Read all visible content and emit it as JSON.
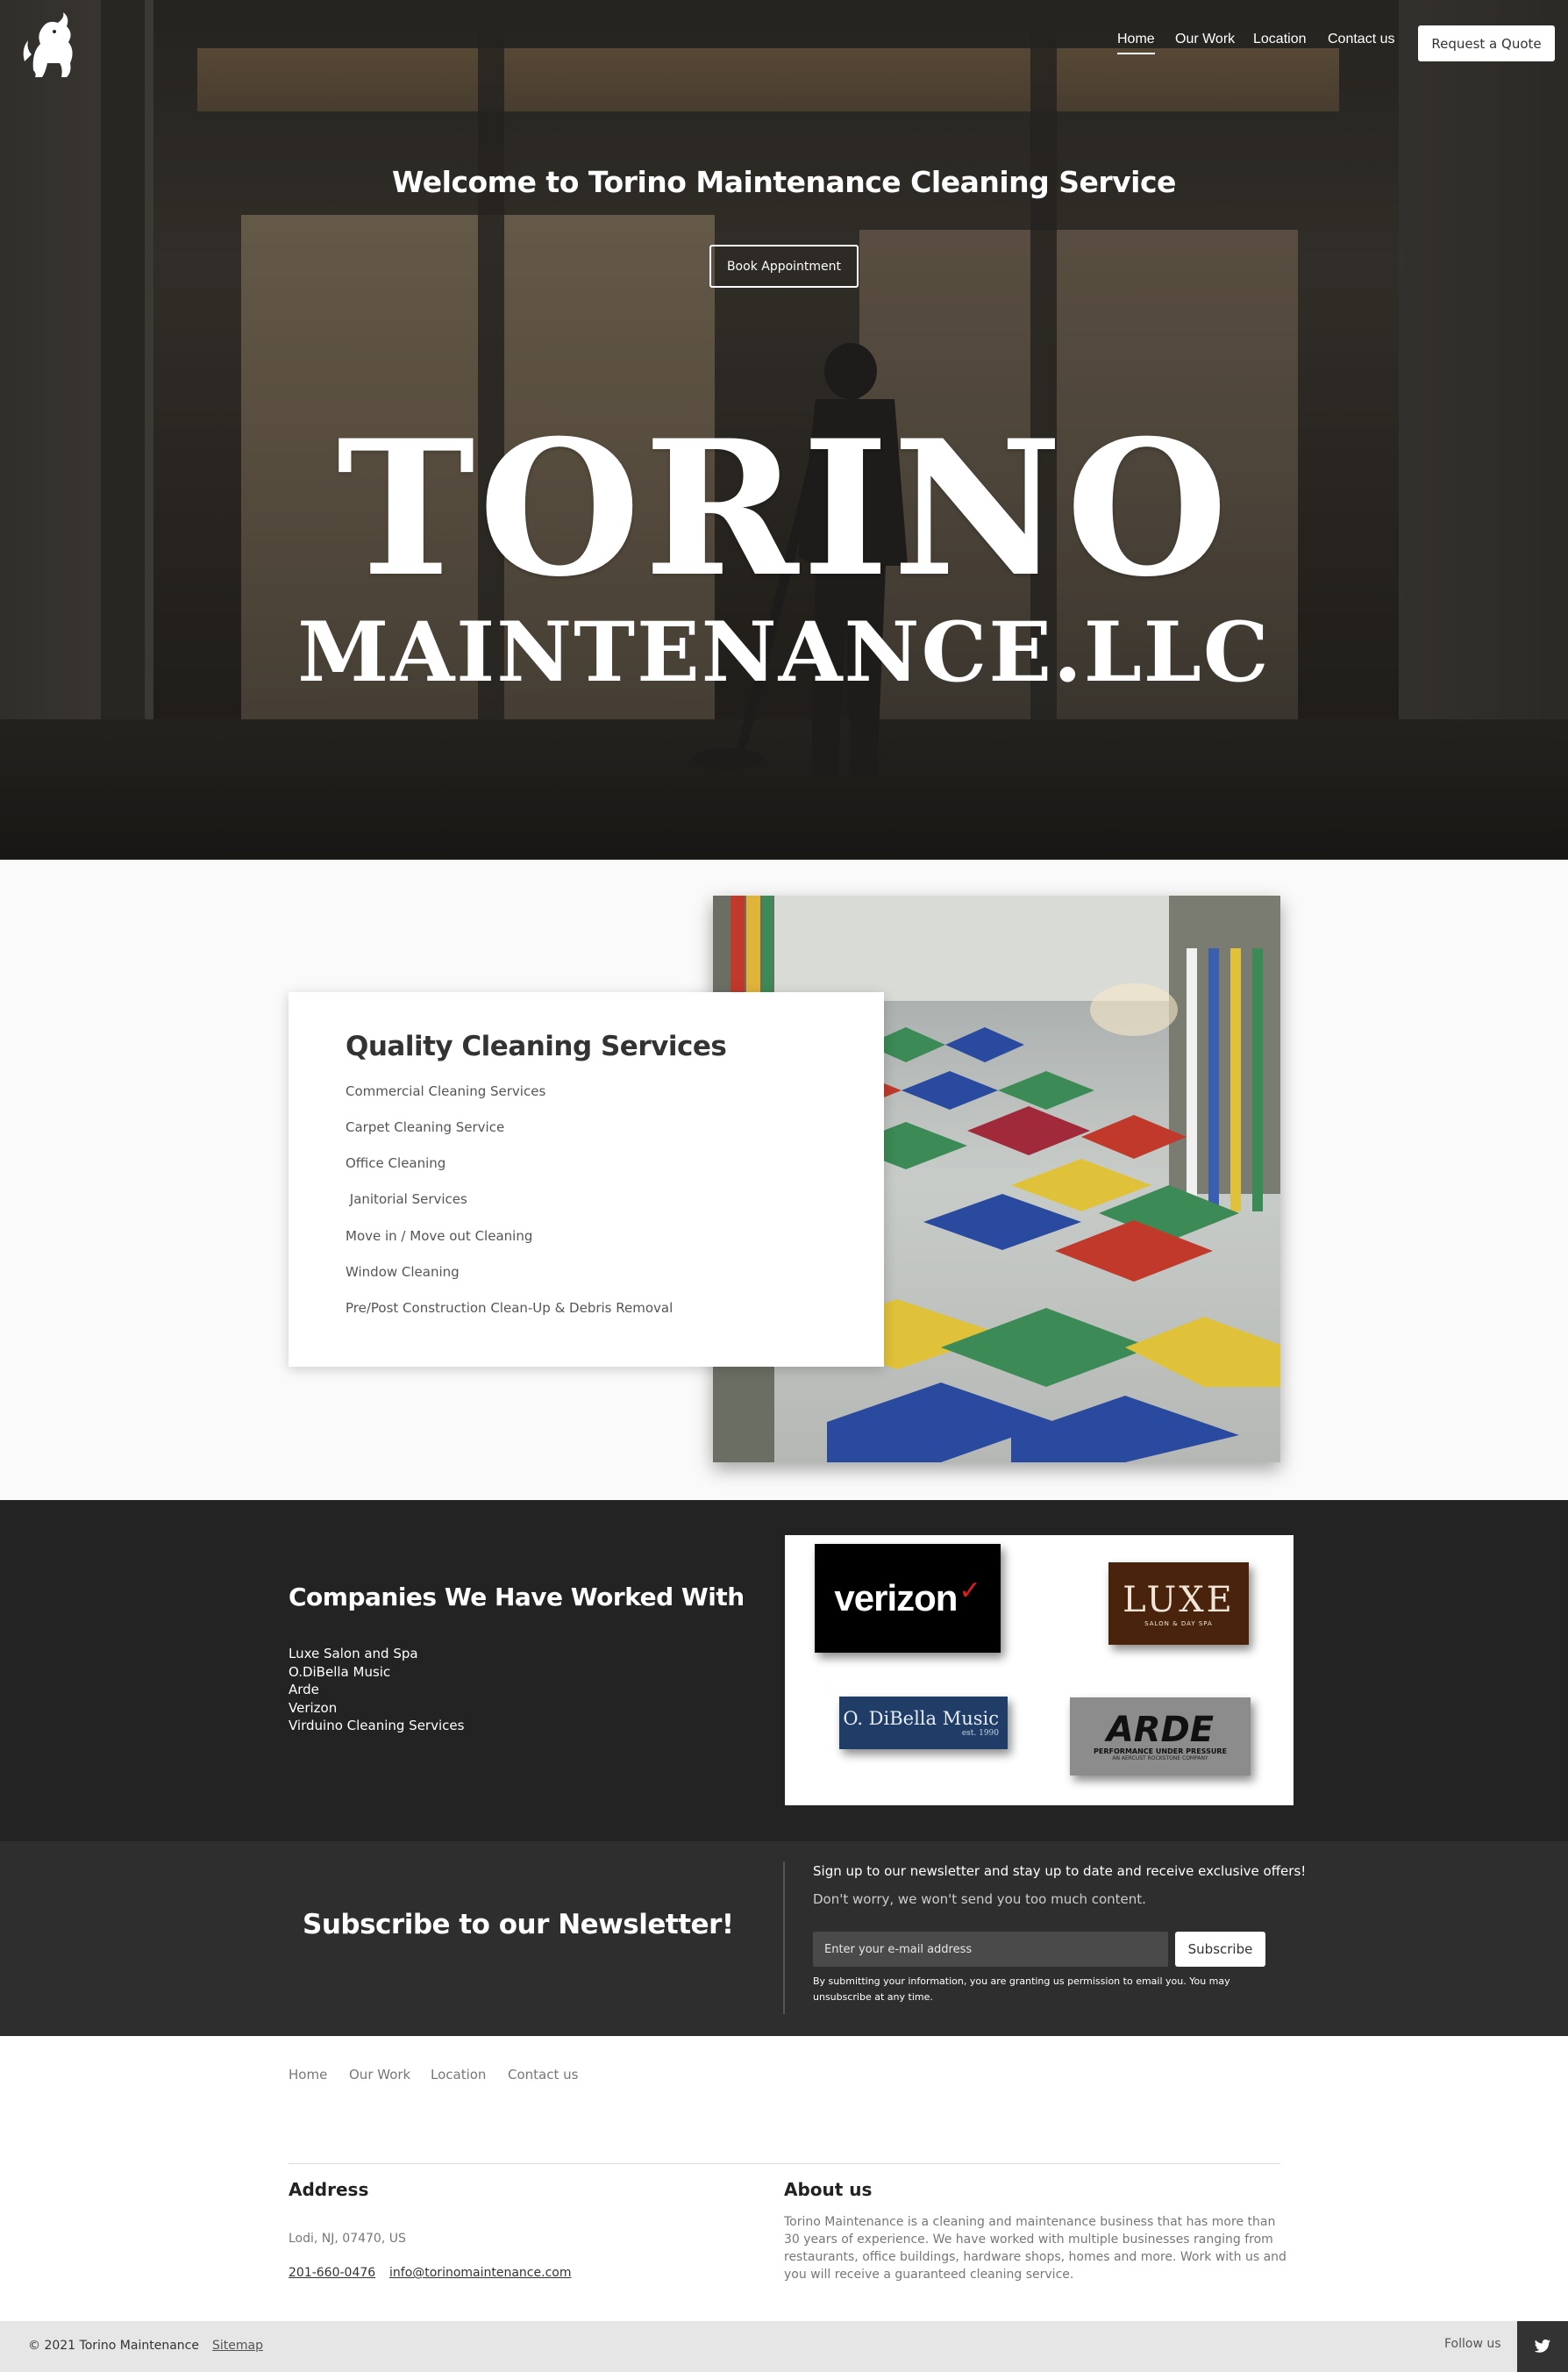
{
  "header": {
    "nav": [
      "Home",
      "Our Work",
      "Location",
      "Contact us"
    ],
    "quote_button": "Request a Quote"
  },
  "hero": {
    "title": "Welcome to Torino Maintenance Cleaning Service",
    "book_button": "Book Appointment",
    "brand_line1": "TORINO",
    "brand_line2": "MAINTENANCE.LLC"
  },
  "services": {
    "title": "Quality Cleaning Services",
    "items": [
      "Commercial Cleaning Services",
      "Carpet Cleaning Service",
      "Office Cleaning",
      " Janitorial Services",
      "Move in / Move out Cleaning",
      "Window Cleaning",
      "Pre/Post Construction Clean-Up & Debris Removal"
    ]
  },
  "companies": {
    "title": "Companies We Have Worked With",
    "items": [
      "Luxe Salon and Spa",
      "O.DiBella Music",
      "Arde",
      "Verizon",
      "Virduino Cleaning Services"
    ],
    "logos": {
      "verizon": "verizon",
      "luxe": "LUXE",
      "luxe_sub": "SALON & DAY SPA",
      "dibella": "O. DiBella Music",
      "dibella_sub": "est. 1990",
      "arde": "ARDE",
      "arde_sub": "PERFORMANCE UNDER PRESSURE",
      "arde_sub2": "AN AERCUST ROCKSTONE COMPANY"
    }
  },
  "newsletter": {
    "title": "Subscribe to our Newsletter!",
    "headline": "Sign up to our newsletter and stay up to date and receive exclusive offers!",
    "subtext": "Don't worry, we won't send you too much content.",
    "placeholder": "Enter your e-mail address",
    "button": "Subscribe",
    "legal": "By submitting your information, you are granting us permission to email you. You may unsubscribe at any time."
  },
  "footer": {
    "nav": [
      "Home",
      "Our Work",
      "Location",
      "Contact us"
    ],
    "address_heading": "Address",
    "address": "Lodi, NJ, 07470, US",
    "phone": "201-660-0476",
    "email": "info@torinomaintenance.com",
    "about_heading": "About us",
    "about_text": "Torino Maintenance is a cleaning and maintenance business that has more than 30 years of experience. We have worked with multiple businesses ranging from restaurants, office buildings, hardware shops, homes and more. Work with us and you will receive a guaranteed cleaning service.",
    "copyright": "© 2021 Torino Maintenance",
    "sitemap": "Sitemap",
    "follow": "Follow us"
  }
}
